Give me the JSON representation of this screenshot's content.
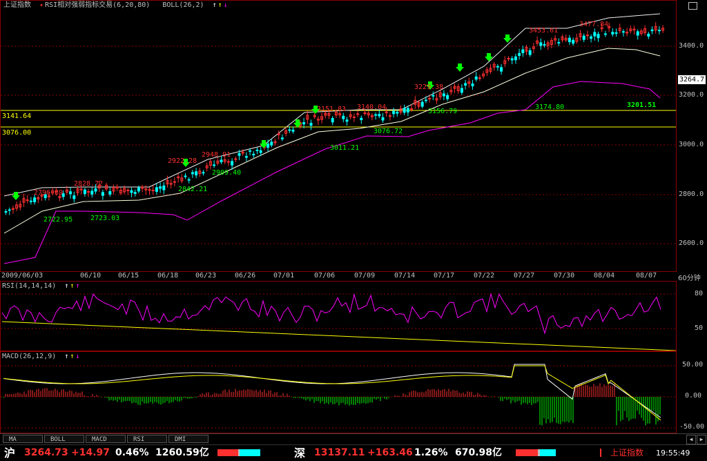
{
  "header": {
    "main": {
      "name": "上证指数",
      "indicator": "RSI相对强弱指标交易(6,20,80)",
      "boll": "BOLL(26,2)"
    },
    "rsi": {
      "label": "RSI(14,14,14)"
    },
    "macd": {
      "label": "MACD(26,12,9)"
    }
  },
  "price_axis": [
    "3400.0",
    "3200.0",
    "3000.0",
    "2800.0",
    "2600.0"
  ],
  "rsi_axis": [
    "80",
    "50"
  ],
  "macd_axis": [
    "50.00",
    "0.00",
    "-50.00"
  ],
  "current_price_tag": "3264.7",
  "hlines": [
    {
      "label": "3141.64"
    },
    {
      "label": "3076.00"
    }
  ],
  "annotations": {
    "high": [
      "2796.89",
      "2828.72",
      "2922.28",
      "2948.91",
      "3151.83",
      "3140.04",
      "3229.38",
      "3453.61",
      "3477.84"
    ],
    "low": [
      "2722.95",
      "2723.03",
      "2842.21",
      "2909.40",
      "3011.21",
      "3076.72",
      "3156.79",
      "3174.80"
    ],
    "last_low": "3201.51"
  },
  "dates": [
    "2009/06/03",
    "06/10",
    "06/15",
    "06/18",
    "06/23",
    "06/26",
    "07/01",
    "07/06",
    "07/09",
    "07/14",
    "07/17",
    "07/22",
    "07/27",
    "07/30",
    "08/04",
    "08/07"
  ],
  "period_label": "60分钟",
  "tabs": [
    "MA",
    "BOLL",
    "MACD",
    "RSI",
    "DMI"
  ],
  "status": {
    "sh": {
      "name": "沪",
      "price": "3264.73",
      "change": "+14.97",
      "pct": "0.46%",
      "amount": "1260.59亿"
    },
    "sz": {
      "name": "深",
      "price": "13137.11",
      "change": "+163.46",
      "pct": "1.26%",
      "amount": "670.98亿"
    },
    "index_name": "上证指数",
    "time": "19:55:49"
  },
  "colors": {
    "up": "#ff3030",
    "down": "#00ffff",
    "yellow": "#ffff00",
    "magenta": "#ff00ff",
    "green": "#00ff00",
    "white": "#ffffff",
    "grid": "#8b0000"
  }
}
